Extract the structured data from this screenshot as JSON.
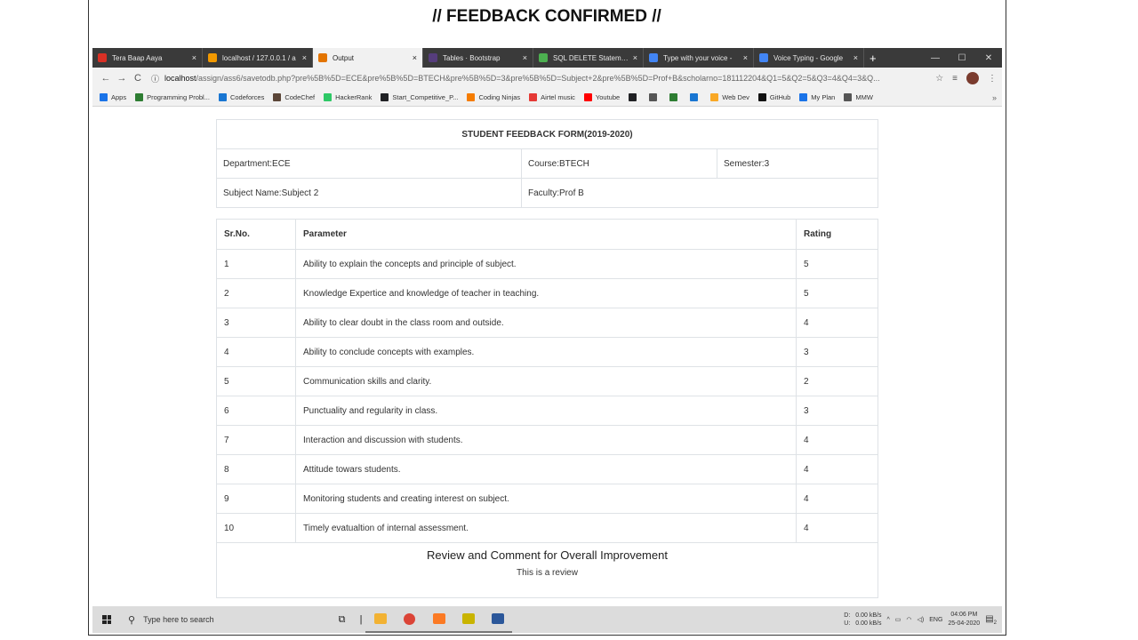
{
  "slide": {
    "title": "// FEEDBACK CONFIRMED //"
  },
  "browser": {
    "tabs": [
      {
        "label": "Tera Baap Aaya",
        "color": "#d93025",
        "active": false
      },
      {
        "label": "localhost / 127.0.0.1 / a",
        "color": "#f29900",
        "active": false
      },
      {
        "label": "Output",
        "color": "#e37400",
        "active": true
      },
      {
        "label": "Tables · Bootstrap",
        "color": "#563d7c",
        "active": false
      },
      {
        "label": "SQL DELETE Statement",
        "color": "#4caf50",
        "active": false
      },
      {
        "label": "Type with your voice -",
        "color": "#4285f4",
        "active": false
      },
      {
        "label": "Voice Typing - Google",
        "color": "#4285f4",
        "active": false
      }
    ],
    "new_tab": "+",
    "window_controls": {
      "minimize": "—",
      "maximize": "☐",
      "close": "✕"
    },
    "address": {
      "host": "localhost",
      "path": "/assign/ass6/savetodb.php?pre%5B%5D=ECE&pre%5B%5D=BTECH&pre%5B%5D=3&pre%5B%5D=Subject+2&pre%5B%5D=Prof+B&scholarno=181112204&Q1=5&Q2=5&Q3=4&Q4=3&Q..."
    },
    "bookmarks": [
      {
        "label": "Apps",
        "color": "#1a73e8"
      },
      {
        "label": "Programming Probl...",
        "color": "#2e7d32"
      },
      {
        "label": "Codeforces",
        "color": "#1976d2"
      },
      {
        "label": "CodeChef",
        "color": "#5b4638"
      },
      {
        "label": "HackerRank",
        "color": "#2ec866"
      },
      {
        "label": "Start_Competitive_P...",
        "color": "#202124"
      },
      {
        "label": "Coding Ninjas",
        "color": "#f57c00"
      },
      {
        "label": "Airtel music",
        "color": "#e53935"
      },
      {
        "label": "Youtube",
        "color": "#ff0000"
      },
      {
        "label": "",
        "color": "#202124"
      },
      {
        "label": "",
        "color": "#555555"
      },
      {
        "label": "",
        "color": "#2e7d32"
      },
      {
        "label": "",
        "color": "#1976d2"
      },
      {
        "label": "Web Dev",
        "color": "#f9a825"
      },
      {
        "label": "GitHub",
        "color": "#111111"
      },
      {
        "label": "My Plan",
        "color": "#1a73e8"
      },
      {
        "label": "MMW",
        "color": "#555555"
      }
    ],
    "more": "»"
  },
  "form": {
    "title": "STUDENT FEEDBACK FORM(2019-2020)",
    "department": "Department:ECE",
    "course": "Course:BTECH",
    "semester": "Semester:3",
    "subject": "Subject Name:Subject 2",
    "faculty": "Faculty:Prof B"
  },
  "table": {
    "headers": {
      "sr": "Sr.No.",
      "parameter": "Parameter",
      "rating": "Rating"
    },
    "rows": [
      {
        "sr": "1",
        "parameter": "Ability to explain the concepts and principle of subject.",
        "rating": "5"
      },
      {
        "sr": "2",
        "parameter": "Knowledge Expertice and knowledge of teacher in teaching.",
        "rating": "5"
      },
      {
        "sr": "3",
        "parameter": "Ability to clear doubt in the class room and outside.",
        "rating": "4"
      },
      {
        "sr": "4",
        "parameter": "Ability to conclude concepts with examples.",
        "rating": "3"
      },
      {
        "sr": "5",
        "parameter": "Communication skills and clarity.",
        "rating": "2"
      },
      {
        "sr": "6",
        "parameter": "Punctuality and regularity in class.",
        "rating": "3"
      },
      {
        "sr": "7",
        "parameter": "Interaction and discussion with students.",
        "rating": "4"
      },
      {
        "sr": "8",
        "parameter": "Attitude towars students.",
        "rating": "4"
      },
      {
        "sr": "9",
        "parameter": "Monitoring students and creating interest on subject.",
        "rating": "4"
      },
      {
        "sr": "10",
        "parameter": "Timely evatualtion of internal assessment.",
        "rating": "4"
      }
    ]
  },
  "review": {
    "heading": "Review and Comment for Overall Improvement",
    "text": "This is a review"
  },
  "taskbar": {
    "search_placeholder": "Type here to search",
    "net_down": "0.00 kB/s",
    "net_up": "0.00 kB/s",
    "drive_d": "D:",
    "drive_u": "U:",
    "language": "ENG",
    "time": "04:06 PM",
    "date": "25-04-2020",
    "notification_count": "2"
  }
}
